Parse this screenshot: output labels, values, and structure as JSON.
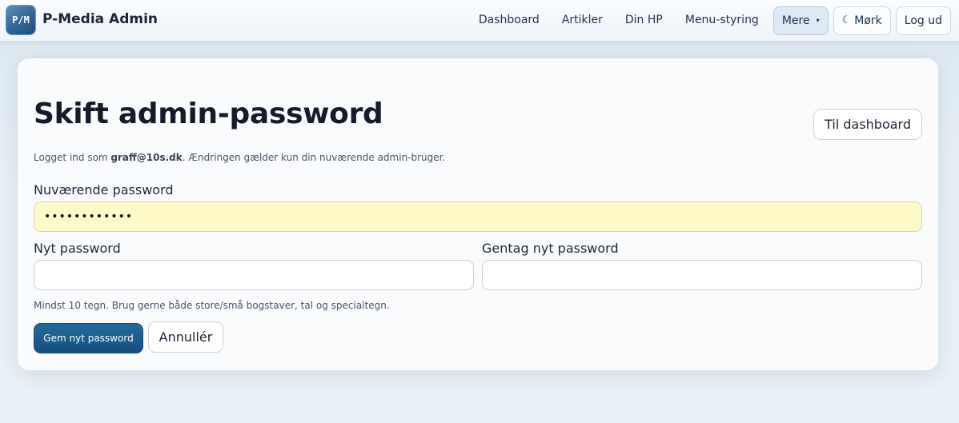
{
  "app": {
    "logo_text": "P/M",
    "brand": "P-Media Admin"
  },
  "nav": {
    "dashboard": "Dashboard",
    "artikler": "Artikler",
    "din_hp": "Din HP",
    "menu_styring": "Menu-styring",
    "mere": "Mere",
    "mere_caret": "▾",
    "dark_icon": "☾",
    "dark_label": "Mørk",
    "logout": "Log ud"
  },
  "page": {
    "title": "Skift admin-password",
    "dashboard_button": "Til dashboard",
    "info_prefix": "Logget ind som ",
    "info_user": "graff@10s.dk",
    "info_suffix": ". Ændringen gælder kun din nuværende admin-bruger."
  },
  "form": {
    "current_label": "Nuværende password",
    "current_value": "••••••••••••",
    "new_label": "Nyt password",
    "new_value": "",
    "repeat_label": "Gentag nyt password",
    "repeat_value": "",
    "hint": "Mindst 10 tegn. Brug gerne både store/små bogstaver, tal og specialtegn.",
    "save_label": "Gem nyt password",
    "cancel_label": "Annullér"
  },
  "colors": {
    "primary": "#1a5c8c",
    "autofill": "#fdf9c8",
    "card": "#f9fbfd"
  }
}
